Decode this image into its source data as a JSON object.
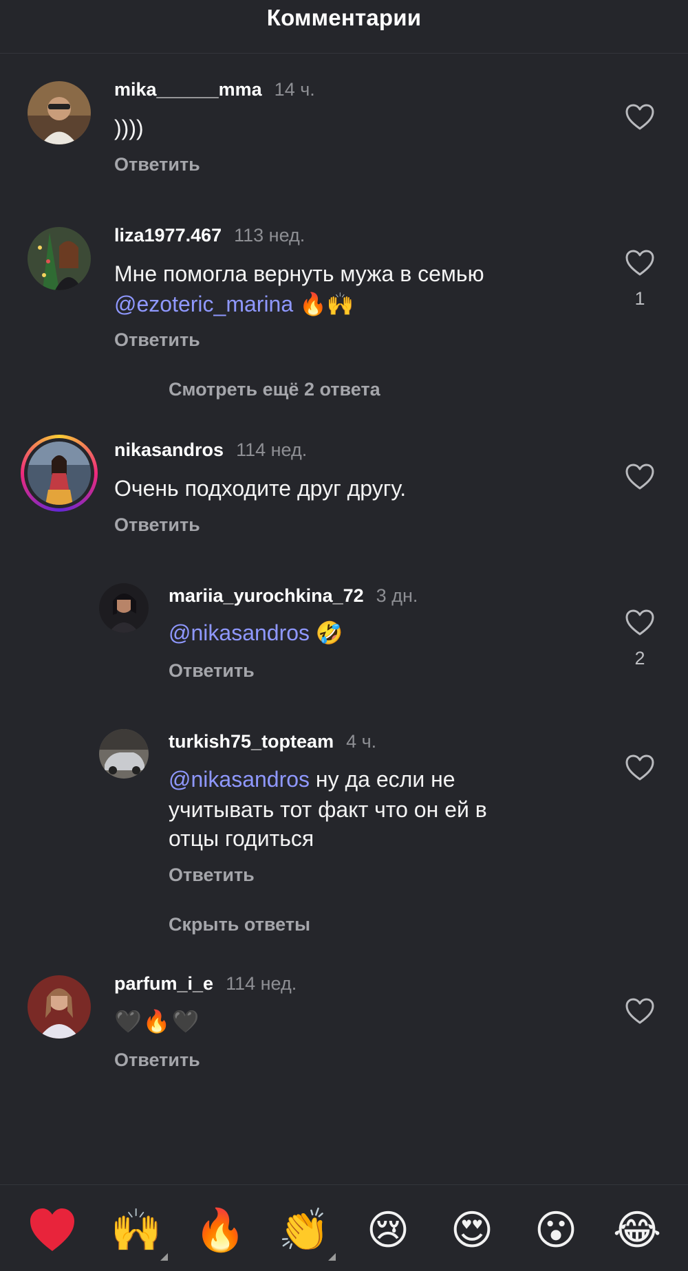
{
  "header": {
    "title": "Комментарии"
  },
  "comments": [
    {
      "username": "mika______mma",
      "time": "14 ч.",
      "text": "))))",
      "reply_label": "Ответить",
      "likes": ""
    },
    {
      "username": "liza1977.467",
      "time": "113 нед.",
      "text_line1": "Мне помогла вернуть мужа в семью",
      "mention": "@ezoteric_marina",
      "emojis": "🔥🙌",
      "reply_label": "Ответить",
      "likes": "1",
      "view_more": "Смотреть ещё 2 ответа"
    },
    {
      "username": "nikasandros",
      "time": "114 нед.",
      "text": "Очень подходите друг другу.",
      "reply_label": "Ответить",
      "likes": ""
    },
    {
      "username": "mariia_yurochkina_72",
      "time": "3 дн.",
      "mention": "@nikasandros",
      "emojis": "🤣",
      "reply_label": "Ответить",
      "likes": "2"
    },
    {
      "username": "turkish75_topteam",
      "time": "4 ч.",
      "mention": "@nikasandros",
      "text_rest1": " ну да если не",
      "text_line2": "учитывать тот факт что он ей в",
      "text_line3": "отцы годиться",
      "reply_label": "Ответить",
      "likes": "",
      "hide_replies": "Скрыть ответы"
    },
    {
      "username": "parfum_i_e",
      "time": "114 нед.",
      "emojis": "🖤🔥🖤",
      "reply_label": "Ответить",
      "likes": ""
    }
  ],
  "reactions": [
    "❤️",
    "🙌",
    "🔥",
    "👏",
    "😢",
    "😍",
    "😮",
    "😂"
  ],
  "colors": {
    "background": "#25262b",
    "mention": "#8f98ff",
    "secondary_text": "#a5a6ab",
    "heart_red": "#e8243b"
  }
}
